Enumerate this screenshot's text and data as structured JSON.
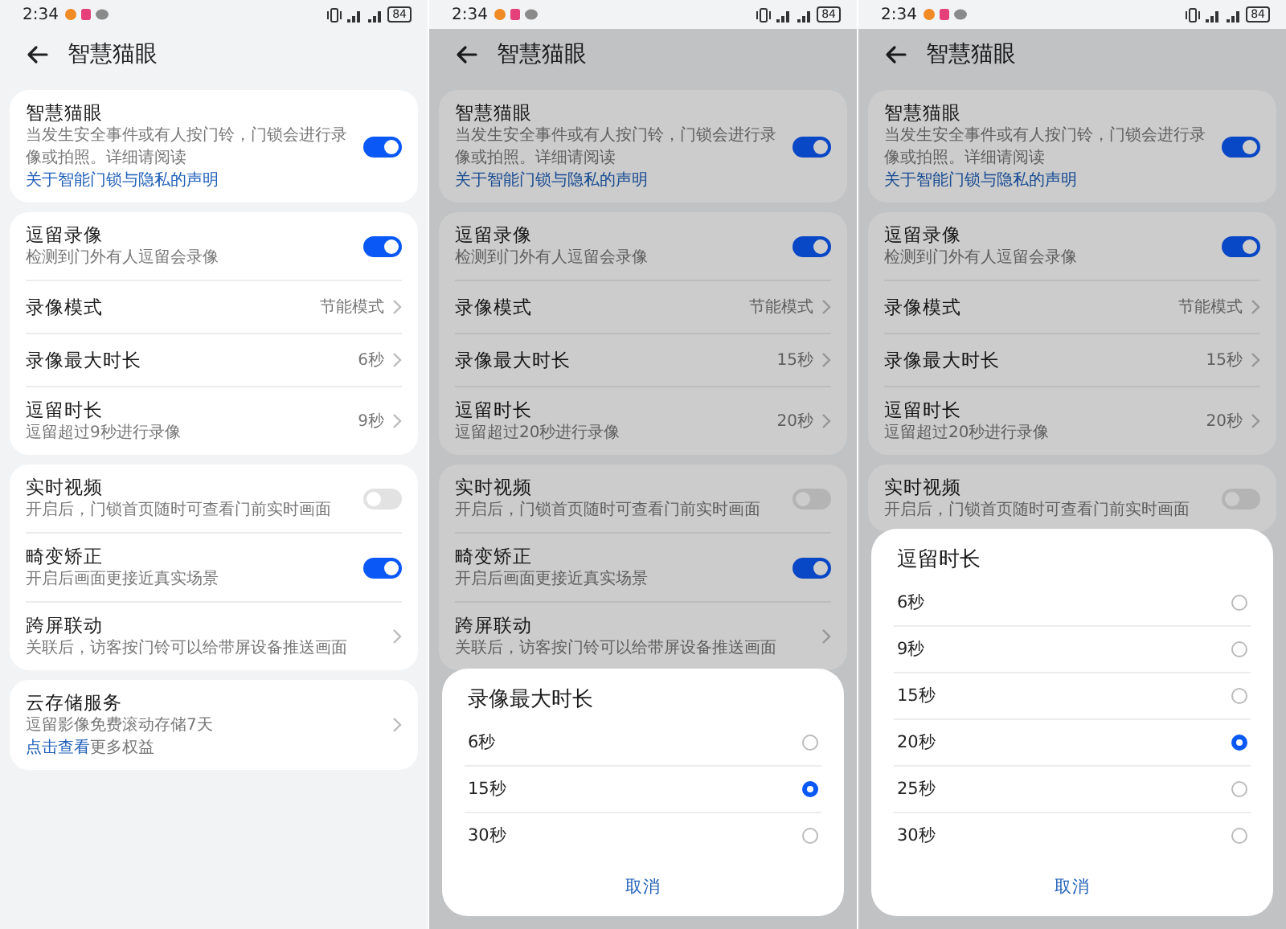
{
  "screens": [
    {
      "status_bar": {
        "time": "2:34",
        "battery": "84"
      },
      "title": "智慧猫眼",
      "groups": [
        {
          "items": [
            {
              "kind": "toggle",
              "title": "智慧猫眼",
              "subtitle": "当发生安全事件或有人按门铃，门锁会进行录像或拍照。详细请阅读 ",
              "link": "关于智能门锁与隐私的声明",
              "on": true
            }
          ]
        },
        {
          "items": [
            {
              "kind": "toggle",
              "title": "逗留录像",
              "subtitle": "检测到门外有人逗留会录像",
              "on": true
            },
            {
              "kind": "nav",
              "title": "录像模式",
              "value": "节能模式"
            },
            {
              "kind": "nav",
              "title": "录像最大时长",
              "value": "6秒"
            },
            {
              "kind": "nav",
              "title": "逗留时长",
              "subtitle": "逗留超过9秒进行录像",
              "value": "9秒"
            }
          ]
        },
        {
          "items": [
            {
              "kind": "toggle",
              "title": "实时视频",
              "subtitle": "开启后，门锁首页随时可查看门前实时画面",
              "on": false
            },
            {
              "kind": "toggle",
              "title": "畸变矫正",
              "subtitle": "开启后画面更接近真实场景",
              "on": true
            },
            {
              "kind": "nav",
              "title": "跨屏联动",
              "subtitle": "关联后，访客按门铃可以给带屏设备推送画面"
            }
          ]
        },
        {
          "items": [
            {
              "kind": "nav",
              "title": "云存储服务",
              "subtitle": "逗留影像免费滚动存储7天",
              "link": "点击查看",
              "link_after": "更多权益",
              "link_on_new_line": true
            }
          ]
        }
      ]
    },
    {
      "status_bar": {
        "time": "2:34",
        "battery": "84"
      },
      "title": "智慧猫眼",
      "groups": [
        {
          "items": [
            {
              "kind": "toggle",
              "title": "智慧猫眼",
              "subtitle": "当发生安全事件或有人按门铃，门锁会进行录像或拍照。详细请阅读 ",
              "link": "关于智能门锁与隐私的声明",
              "on": true
            }
          ]
        },
        {
          "items": [
            {
              "kind": "toggle",
              "title": "逗留录像",
              "subtitle": "检测到门外有人逗留会录像",
              "on": true
            },
            {
              "kind": "nav",
              "title": "录像模式",
              "value": "节能模式"
            },
            {
              "kind": "nav",
              "title": "录像最大时长",
              "value": "15秒"
            },
            {
              "kind": "nav",
              "title": "逗留时长",
              "subtitle": "逗留超过20秒进行录像",
              "value": "20秒"
            }
          ]
        },
        {
          "items": [
            {
              "kind": "toggle",
              "title": "实时视频",
              "subtitle": "开启后，门锁首页随时可查看门前实时画面",
              "on": false
            },
            {
              "kind": "toggle",
              "title": "畸变矫正",
              "subtitle": "开启后画面更接近真实场景",
              "on": true
            },
            {
              "kind": "nav",
              "title": "跨屏联动",
              "subtitle": "关联后，访客按门铃可以给带屏设备推送画面"
            }
          ]
        }
      ],
      "dialog": {
        "title": "录像最大时长",
        "options": [
          {
            "label": "6秒",
            "selected": false
          },
          {
            "label": "15秒",
            "selected": true
          },
          {
            "label": "30秒",
            "selected": false
          }
        ],
        "cancel": "取消"
      }
    },
    {
      "status_bar": {
        "time": "2:34",
        "battery": "84"
      },
      "title": "智慧猫眼",
      "groups": [
        {
          "items": [
            {
              "kind": "toggle",
              "title": "智慧猫眼",
              "subtitle": "当发生安全事件或有人按门铃，门锁会进行录像或拍照。详细请阅读 ",
              "link": "关于智能门锁与隐私的声明",
              "on": true
            }
          ]
        },
        {
          "items": [
            {
              "kind": "toggle",
              "title": "逗留录像",
              "subtitle": "检测到门外有人逗留会录像",
              "on": true
            },
            {
              "kind": "nav",
              "title": "录像模式",
              "value": "节能模式"
            },
            {
              "kind": "nav",
              "title": "录像最大时长",
              "value": "15秒"
            },
            {
              "kind": "nav",
              "title": "逗留时长",
              "subtitle": "逗留超过20秒进行录像",
              "value": "20秒"
            }
          ]
        },
        {
          "items": [
            {
              "kind": "toggle",
              "title": "实时视频",
              "subtitle": "开启后，门锁首页随时可查看门前实时画面",
              "on": false
            }
          ]
        }
      ],
      "dialog": {
        "title": "逗留时长",
        "options": [
          {
            "label": "6秒",
            "selected": false
          },
          {
            "label": "9秒",
            "selected": false
          },
          {
            "label": "15秒",
            "selected": false
          },
          {
            "label": "20秒",
            "selected": true
          },
          {
            "label": "25秒",
            "selected": false
          },
          {
            "label": "30秒",
            "selected": false
          }
        ],
        "cancel": "取消"
      }
    }
  ]
}
